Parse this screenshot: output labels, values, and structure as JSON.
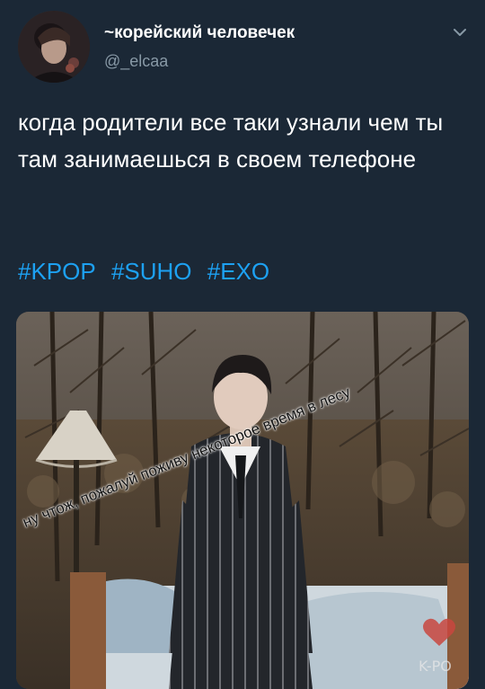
{
  "tweet": {
    "display_name": "~корейский человечек",
    "handle": "@_elcaa",
    "text": "когда родители все таки узнали чем ты там занимаешься в своем телефоне",
    "hashtags": [
      "#KPOP",
      "#SUHO",
      "#EXO"
    ]
  },
  "media": {
    "caption": "ну чтож, пожалуй поживу некоторое время в лесу"
  },
  "colors": {
    "background": "#1b2836",
    "link": "#1da1f2",
    "secondary_text": "#8899a6"
  },
  "icons": {
    "caret": "chevron-down-icon"
  }
}
